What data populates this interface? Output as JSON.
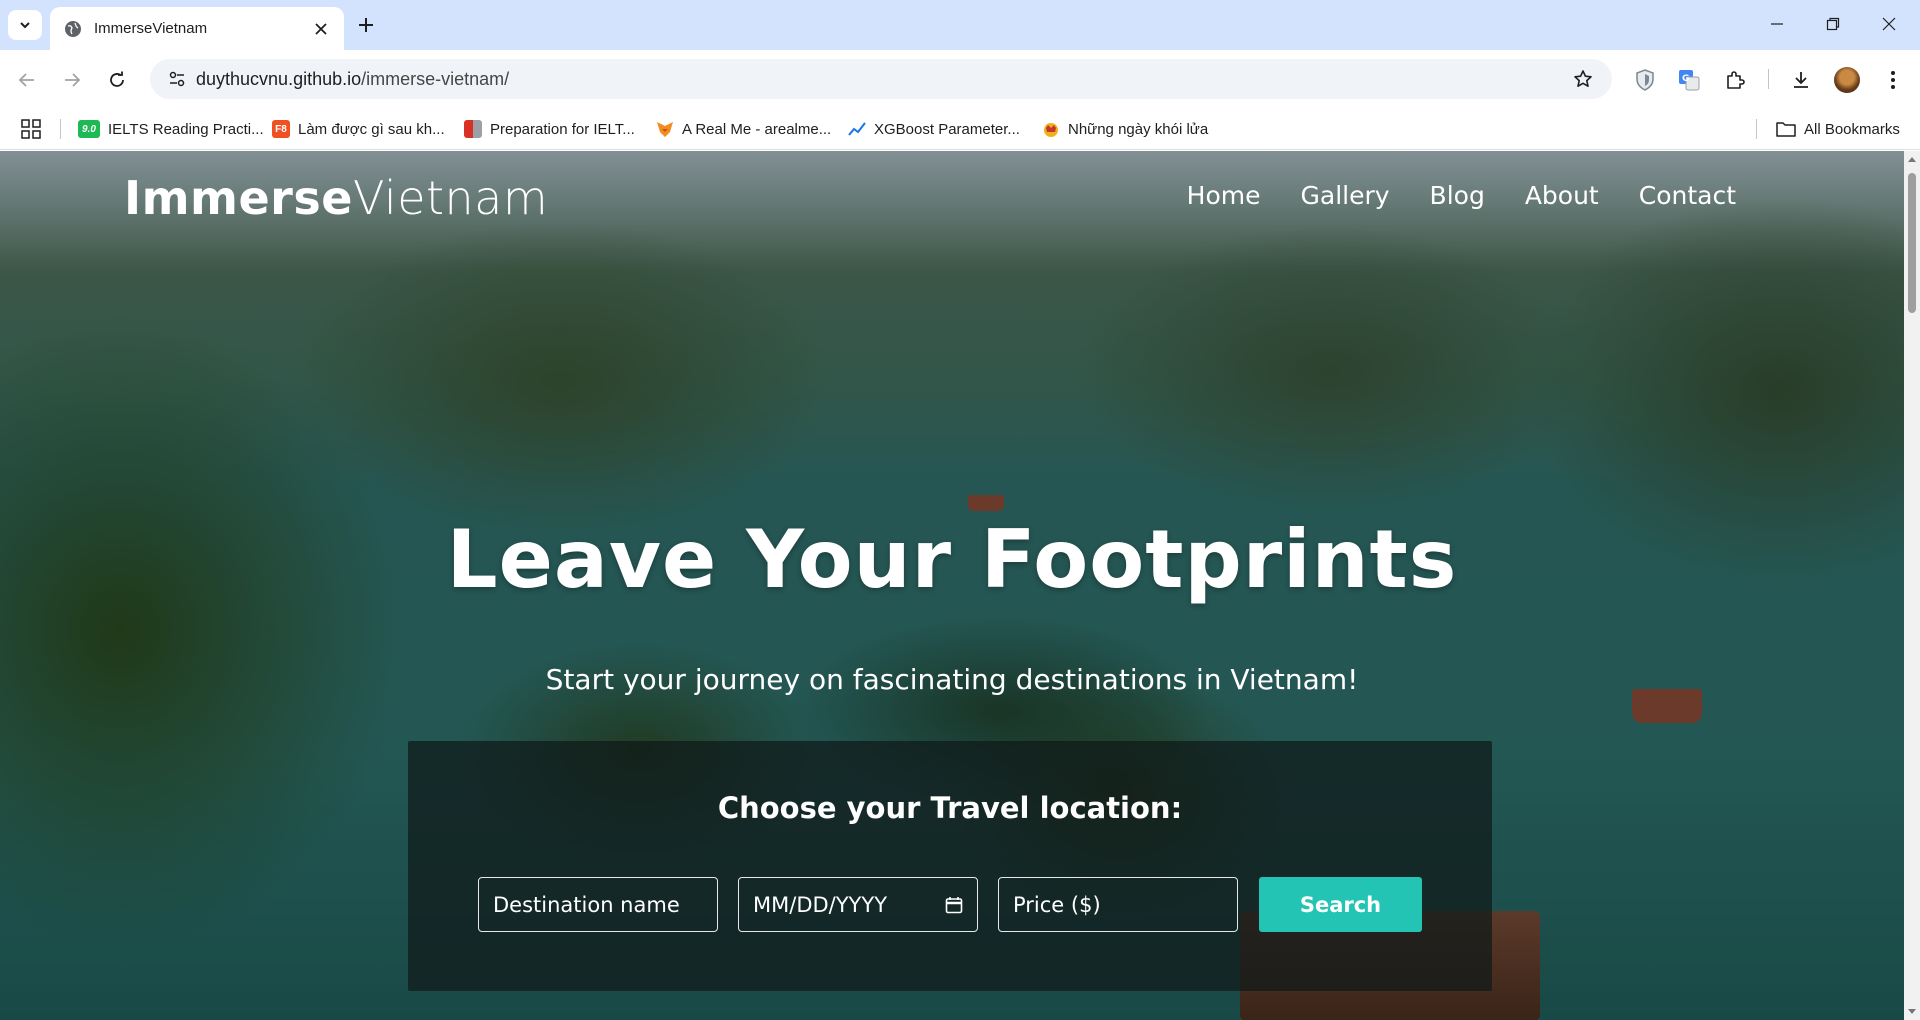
{
  "browser": {
    "tab": {
      "title": "ImmerseVietnam"
    },
    "url": {
      "host": "duythucvnu.github.io",
      "path": "/immerse-vietnam/"
    },
    "bookmarks": [
      {
        "label": "IELTS Reading Practi...",
        "icon": "ielts-favicon",
        "color": "#1db954",
        "badge": "9.0"
      },
      {
        "label": "Làm được gì sau kh...",
        "icon": "f8-favicon",
        "color": "#f05123",
        "badge": "F8"
      },
      {
        "label": "Preparation for IELT...",
        "icon": "grid-favicon",
        "color": "#d93025",
        "badge": ""
      },
      {
        "label": "A Real Me - arealme...",
        "icon": "fox-favicon",
        "color": "#f28c1e",
        "badge": ""
      },
      {
        "label": "XGBoost Parameter...",
        "icon": "chart-favicon",
        "color": "#1a73e8",
        "badge": ""
      },
      {
        "label": "Những ngày khói lửa",
        "icon": "crown-favicon",
        "color": "#f2b01e",
        "badge": ""
      }
    ],
    "all_bookmarks": "All Bookmarks"
  },
  "site": {
    "logo_bold": "Immerse",
    "logo_light": "Vietnam",
    "nav": [
      "Home",
      "Gallery",
      "Blog",
      "About",
      "Contact"
    ],
    "hero_title": "Leave Your Footprints",
    "hero_subtitle": "Start your journey on fascinating destinations in Vietnam!",
    "search": {
      "title": "Choose your Travel location:",
      "destination_placeholder": "Destination name",
      "date_placeholder": "MM/DD/YYYY",
      "price_placeholder": "Price ($)",
      "button": "Search"
    },
    "accent_color": "#23c4b4"
  }
}
